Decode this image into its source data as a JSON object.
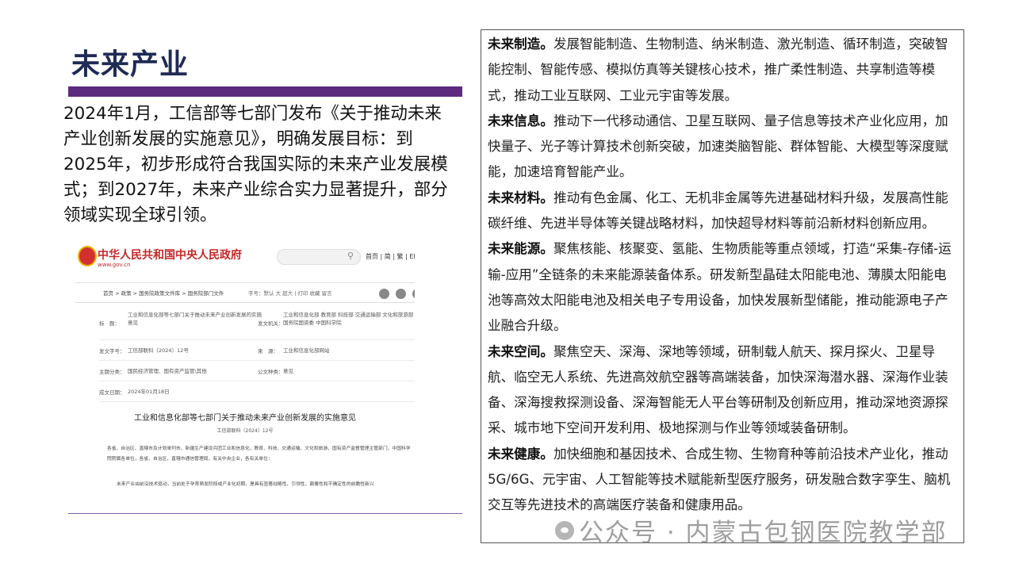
{
  "slide": {
    "title": "未来产业",
    "intro": "2024年1月，工信部等七部门发布《关于推动未来产业创新发展的实施意见》，明确发展目标：到2025年，初步形成符合我国实际的未来产业发展模式；到2027年，未来产业综合实力显著提升，部分领域实现全球引领。"
  },
  "gov_doc": {
    "site_title": "中华人民共和国中央人民政府",
    "site_url": "www.gov.cn",
    "top_links": "首页 | 简 | 繁 | EN",
    "breadcrumb": "首页 > 政策 > 国务院政策文件库 > 国务院部门文件",
    "tools": "字号：默认 大 超大  |  打印  收藏  留言",
    "meta_rows": [
      {
        "l_label": "标　题：",
        "l_value": "工业和信息化部等七部门关于推动未来产业创新发展的实施意见",
        "r_label": "发文机关：",
        "r_value": "工业和信息化部 教育部 科技部 交通运输部 文化和旅游部 国务院国资委 中国科学院"
      },
      {
        "l_label": "发文字号：",
        "l_value": "工信部联科〔2024〕12号",
        "r_label": "来　源：",
        "r_value": "工业和信息化部网站"
      },
      {
        "l_label": "主题分类：",
        "l_value": "国民经济管理、国有资产监管\\其他",
        "r_label": "公文种类：",
        "r_value": "意见"
      },
      {
        "l_label": "成文日期：",
        "l_value": "2024年01月18日",
        "r_label": "",
        "r_value": ""
      }
    ],
    "doc_title": "工业和信息化部等七部门关于推动未来产业创新发展的实施意见",
    "doc_number": "工信部联科〔2024〕12号",
    "doc_body": "各省、自治区、直辖市及计划单列市、新疆生产建设兵团工业和信息化、教育、科技、交通运输、文化和旅游、国有资产监督管理主管部门，中国科学院院属各单位，各省、自治区、直辖市通信管理局，有关中央企业，各有关单位：",
    "doc_para2": "未来产业由前沿技术驱动，当前处于孕育萌发阶段或产业化初期，是具有显著战略性、引领性、颠覆性和不确定性的前瞻性新兴"
  },
  "right_box": {
    "items": [
      {
        "head": "未来制造。",
        "body": "发展智能制造、生物制造、纳米制造、激光制造、循环制造，突破智能控制、智能传感、模拟仿真等关键核心技术，推广柔性制造、共享制造等模式，推动工业互联网、工业元宇宙等发展。"
      },
      {
        "head": "未来信息。",
        "body": "推动下一代移动通信、卫星互联网、量子信息等技术产业化应用，加快量子、光子等计算技术创新突破，加速类脑智能、群体智能、大模型等深度赋能，加速培育智能产业。"
      },
      {
        "head": "未来材料。",
        "body": "推动有色金属、化工、无机非金属等先进基础材料升级，发展高性能碳纤维、先进半导体等关键战略材料，加快超导材料等前沿新材料创新应用。"
      },
      {
        "head": "未来能源。",
        "body": "聚焦核能、核聚变、氢能、生物质能等重点领域，打造“采集-存储-运输-应用”全链条的未来能源装备体系。研发新型晶硅太阳能电池、薄膜太阳能电池等高效太阳能电池及相关电子专用设备，加快发展新型储能，推动能源电子产业融合升级。"
      },
      {
        "head": "未来空间。",
        "body": "聚焦空天、深海、深地等领域，研制载人航天、探月探火、卫星导航、临空无人系统、先进高效航空器等高端装备，加快深海潜水器、深海作业装备、深海搜救探测设备、深海智能无人平台等研制及创新应用，推动深地资源探采、城市地下空间开发利用、极地探测与作业等领域装备研制。"
      },
      {
        "head": "未来健康。",
        "body": "加快细胞和基因技术、合成生物、生物育种等前沿技术产业化，推动5G/6G、元宇宙、人工智能等技术赋能新型医疗服务，研发融合数字孪生、脑机交互等先进技术的高端医疗装备和健康用品。"
      }
    ]
  },
  "watermark": {
    "text": "公众号 · 内蒙古包钢医院教学部",
    "icon": "wechat-icon"
  }
}
